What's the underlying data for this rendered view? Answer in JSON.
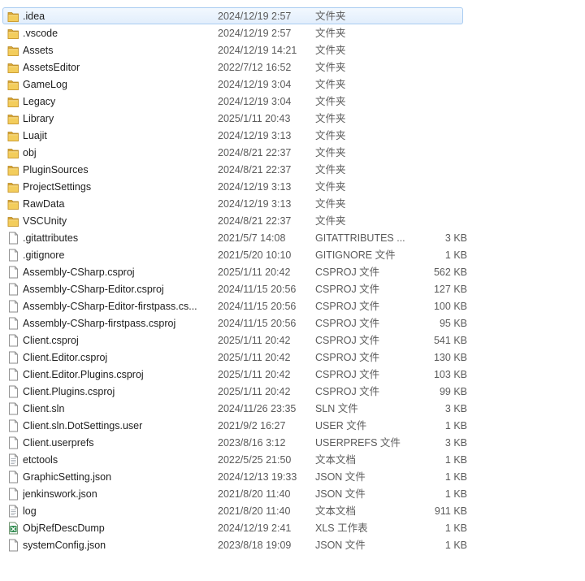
{
  "files": [
    {
      "name": ".idea",
      "date": "2024/12/19 2:57",
      "type": "文件夹",
      "size": "",
      "icon": "folder-icon"
    },
    {
      "name": ".vscode",
      "date": "2024/12/19 2:57",
      "type": "文件夹",
      "size": "",
      "icon": "folder-icon"
    },
    {
      "name": "Assets",
      "date": "2024/12/19 14:21",
      "type": "文件夹",
      "size": "",
      "icon": "folder-icon"
    },
    {
      "name": "AssetsEditor",
      "date": "2022/7/12 16:52",
      "type": "文件夹",
      "size": "",
      "icon": "folder-icon"
    },
    {
      "name": "GameLog",
      "date": "2024/12/19 3:04",
      "type": "文件夹",
      "size": "",
      "icon": "folder-icon"
    },
    {
      "name": "Legacy",
      "date": "2024/12/19 3:04",
      "type": "文件夹",
      "size": "",
      "icon": "folder-icon"
    },
    {
      "name": "Library",
      "date": "2025/1/11 20:43",
      "type": "文件夹",
      "size": "",
      "icon": "folder-icon"
    },
    {
      "name": "Luajit",
      "date": "2024/12/19 3:13",
      "type": "文件夹",
      "size": "",
      "icon": "folder-icon"
    },
    {
      "name": "obj",
      "date": "2024/8/21 22:37",
      "type": "文件夹",
      "size": "",
      "icon": "folder-icon"
    },
    {
      "name": "PluginSources",
      "date": "2024/8/21 22:37",
      "type": "文件夹",
      "size": "",
      "icon": "folder-icon"
    },
    {
      "name": "ProjectSettings",
      "date": "2024/12/19 3:13",
      "type": "文件夹",
      "size": "",
      "icon": "folder-icon"
    },
    {
      "name": "RawData",
      "date": "2024/12/19 3:13",
      "type": "文件夹",
      "size": "",
      "icon": "folder-icon"
    },
    {
      "name": "VSCUnity",
      "date": "2024/8/21 22:37",
      "type": "文件夹",
      "size": "",
      "icon": "folder-icon"
    },
    {
      "name": ".gitattributes",
      "date": "2021/5/7 14:08",
      "type": "GITATTRIBUTES ...",
      "size": "3 KB",
      "icon": "file-icon"
    },
    {
      "name": ".gitignore",
      "date": "2021/5/20 10:10",
      "type": "GITIGNORE 文件",
      "size": "1 KB",
      "icon": "file-icon"
    },
    {
      "name": "Assembly-CSharp.csproj",
      "date": "2025/1/11 20:42",
      "type": "CSPROJ 文件",
      "size": "562 KB",
      "icon": "file-icon"
    },
    {
      "name": "Assembly-CSharp-Editor.csproj",
      "date": "2024/11/15 20:56",
      "type": "CSPROJ 文件",
      "size": "127 KB",
      "icon": "file-icon"
    },
    {
      "name": "Assembly-CSharp-Editor-firstpass.cs...",
      "date": "2024/11/15 20:56",
      "type": "CSPROJ 文件",
      "size": "100 KB",
      "icon": "file-icon"
    },
    {
      "name": "Assembly-CSharp-firstpass.csproj",
      "date": "2024/11/15 20:56",
      "type": "CSPROJ 文件",
      "size": "95 KB",
      "icon": "file-icon"
    },
    {
      "name": "Client.csproj",
      "date": "2025/1/11 20:42",
      "type": "CSPROJ 文件",
      "size": "541 KB",
      "icon": "file-icon"
    },
    {
      "name": "Client.Editor.csproj",
      "date": "2025/1/11 20:42",
      "type": "CSPROJ 文件",
      "size": "130 KB",
      "icon": "file-icon"
    },
    {
      "name": "Client.Editor.Plugins.csproj",
      "date": "2025/1/11 20:42",
      "type": "CSPROJ 文件",
      "size": "103 KB",
      "icon": "file-icon"
    },
    {
      "name": "Client.Plugins.csproj",
      "date": "2025/1/11 20:42",
      "type": "CSPROJ 文件",
      "size": "99 KB",
      "icon": "file-icon"
    },
    {
      "name": "Client.sln",
      "date": "2024/11/26 23:35",
      "type": "SLN 文件",
      "size": "3 KB",
      "icon": "file-icon"
    },
    {
      "name": "Client.sln.DotSettings.user",
      "date": "2021/9/2 16:27",
      "type": "USER 文件",
      "size": "1 KB",
      "icon": "file-icon"
    },
    {
      "name": "Client.userprefs",
      "date": "2023/8/16 3:12",
      "type": "USERPREFS 文件",
      "size": "3 KB",
      "icon": "file-icon"
    },
    {
      "name": "etctools",
      "date": "2022/5/25 21:50",
      "type": "文本文档",
      "size": "1 KB",
      "icon": "text-document-icon"
    },
    {
      "name": "GraphicSetting.json",
      "date": "2024/12/13 19:33",
      "type": "JSON 文件",
      "size": "1 KB",
      "icon": "file-icon"
    },
    {
      "name": "jenkinswork.json",
      "date": "2021/8/20 11:40",
      "type": "JSON 文件",
      "size": "1 KB",
      "icon": "file-icon"
    },
    {
      "name": "log",
      "date": "2021/8/20 11:40",
      "type": "文本文档",
      "size": "911 KB",
      "icon": "text-document-icon"
    },
    {
      "name": "ObjRefDescDump",
      "date": "2024/12/19 2:41",
      "type": "XLS 工作表",
      "size": "1 KB",
      "icon": "spreadsheet-icon"
    },
    {
      "name": "systemConfig.json",
      "date": "2023/8/18 19:09",
      "type": "JSON 文件",
      "size": "1 KB",
      "icon": "file-icon"
    }
  ],
  "selected_index": 0
}
